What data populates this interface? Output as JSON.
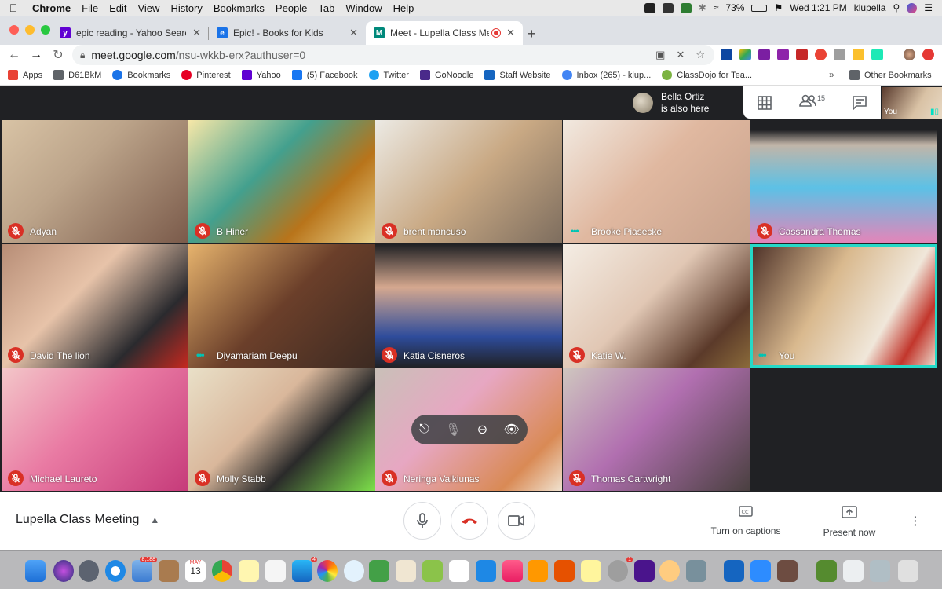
{
  "menubar": {
    "app": "Chrome",
    "items": [
      "File",
      "Edit",
      "View",
      "History",
      "Bookmarks",
      "People",
      "Tab",
      "Window",
      "Help"
    ],
    "battery": "73%",
    "clock": "Wed 1:21 PM",
    "user": "klupella"
  },
  "tabs": [
    {
      "title": "epic reading - Yahoo Search R",
      "fav_color": "#6001d2",
      "fav_glyph": "y"
    },
    {
      "title": "Epic! - Books for Kids",
      "fav_color": "#1a73e8",
      "fav_glyph": "e"
    },
    {
      "title": "Meet - Lupella Class Meeti",
      "fav_color": "#00897b",
      "fav_glyph": "M"
    }
  ],
  "address": {
    "host": "meet.google.com",
    "path": "/nsu-wkkb-erx?authuser=0"
  },
  "bookmarks": [
    {
      "label": "Apps",
      "color": "#e94235"
    },
    {
      "label": "D61BkM",
      "color": "#5f6368"
    },
    {
      "label": "Bookmarks",
      "color": "#1a73e8"
    },
    {
      "label": "Pinterest",
      "color": "#e60023"
    },
    {
      "label": "Yahoo",
      "color": "#6001d2"
    },
    {
      "label": "(5) Facebook",
      "color": "#1877f2"
    },
    {
      "label": "Twitter",
      "color": "#1da1f2"
    },
    {
      "label": "GoNoodle",
      "color": "#4a2a8a"
    },
    {
      "label": "Staff Website",
      "color": "#1565c0"
    },
    {
      "label": "Inbox (265) - klup...",
      "color": "#4285f4"
    },
    {
      "label": "ClassDojo for Tea...",
      "color": "#7cb342"
    }
  ],
  "bookmarks_other": "Other Bookmarks",
  "presence": {
    "name": "Bella Ortiz",
    "text": "is also here"
  },
  "people_count": "15",
  "self_label": "You",
  "participants": [
    {
      "name": "Adyan",
      "status": "muted",
      "bg": "linear-gradient(135deg,#d8c3a5 0%,#bca48a 40%,#7a5a4a 100%)"
    },
    {
      "name": "B Hiner",
      "status": "muted",
      "bg": "linear-gradient(135deg,#f6e7a8 0%,#43a08e 40%,#b8741a 70%,#e9d28b 100%)"
    },
    {
      "name": "brent mancuso",
      "status": "muted",
      "bg": "linear-gradient(135deg,#eceae4 0%,#c9a984 50%,#7d6d5e 100%)"
    },
    {
      "name": "Brooke Piasecke",
      "status": "speaking",
      "bg": "linear-gradient(135deg,#f1e9e0 0%,#e0b8a0 45%,#c7a18b 100%)"
    },
    {
      "name": "Cassandra Thomas",
      "status": "muted",
      "bg": "linear-gradient(180deg,#202124 0%,#202124 8%,#c2b5a8 20%,#5cc1e6 55%,#e684b8 100%)"
    },
    {
      "name": "David The lion",
      "status": "muted",
      "bg": "linear-gradient(135deg,#b78d76 0%,#e7c3a9 40%,#2a2a2e 75%,#c6281f 100%)"
    },
    {
      "name": "Diyamariam Deepu",
      "status": "speaking",
      "bg": "linear-gradient(135deg,#e6b36d 0%,#6b3f2a 50%,#3c2a22 100%)"
    },
    {
      "name": "Katia Cisneros",
      "status": "muted",
      "bg": "linear-gradient(180deg,#202124 0%,#d5a88f 35%,#2e4c9b 75%,#202124 100%)"
    },
    {
      "name": "Katie W.",
      "status": "muted",
      "bg": "linear-gradient(135deg,#f4ede4 0%,#e1c7b4 45%,#5b3a2a 80%,#8a6a3a 100%)"
    },
    {
      "name": "You",
      "status": "speaking",
      "bg": "linear-gradient(120deg,#4a2e26 0%,#d9b98e 40%,#f0e7da 70%,#c2362c 85%,#efe6d8 100%)",
      "me": true
    },
    {
      "name": "Michael Laureto",
      "status": "muted",
      "bg": "linear-gradient(135deg,#f3c7c9 0%,#e97aa3 45%,#c63b7a 100%)"
    },
    {
      "name": "Molly Stabb",
      "status": "muted",
      "bg": "linear-gradient(135deg,#e9e0c8 0%,#d9b79b 40%,#2a2a2a 65%,#7de04a 100%)"
    },
    {
      "name": "Neringa Valkiunas",
      "status": "muted",
      "bg": "linear-gradient(135deg,#c9c0b8 0%,#e7a7c2 40%,#d98a55 80%,#f0e2cf 100%)"
    },
    {
      "name": "Thomas Cartwright",
      "status": "muted",
      "bg": "linear-gradient(135deg,#cfc7bf 0%,#b16fb0 45%,#4a4040 100%)"
    }
  ],
  "meeting_title": "Lupella Class Meeting",
  "captions_label": "Turn on captions",
  "present_label": "Present now",
  "dock_badges": {
    "mail": "8,188",
    "calendar_month": "MAY",
    "calendar_day": "13",
    "appstore": "4",
    "settings": "1"
  },
  "colors": {
    "meet_bg": "#202124",
    "hangup": "#d93025",
    "speaking_outline": "#25d9c7"
  }
}
